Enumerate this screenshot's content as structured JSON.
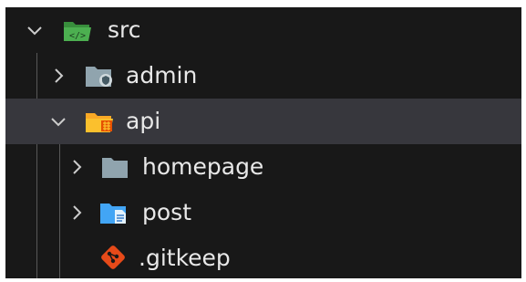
{
  "explorer": {
    "items": [
      {
        "label": "src",
        "icon": "folder-src-open-icon",
        "expanded": true
      },
      {
        "label": "admin",
        "icon": "folder-admin-icon",
        "expanded": false
      },
      {
        "label": "api",
        "icon": "folder-api-open-icon",
        "expanded": true,
        "selected": true
      },
      {
        "label": "homepage",
        "icon": "folder-icon",
        "expanded": false
      },
      {
        "label": "post",
        "icon": "folder-post-icon",
        "expanded": false
      },
      {
        "label": ".gitkeep",
        "icon": "git-icon"
      }
    ]
  },
  "colors": {
    "background": "#181818",
    "selected_row": "#37373d",
    "text": "#e8e8e8",
    "chevron": "#cccccc",
    "indent_guide": "#585858",
    "folder_src": "#4caf50",
    "folder_admin": "#90a4ae",
    "folder_api": "#fbc02d",
    "folder_homepage": "#90a4ae",
    "folder_post": "#42a5f5",
    "git": "#e64a19"
  }
}
